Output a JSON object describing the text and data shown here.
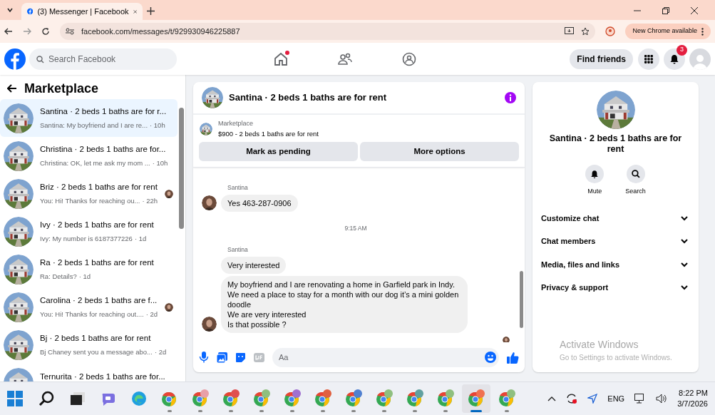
{
  "browser": {
    "tab_title": "(3) Messenger | Facebook",
    "url": "facebook.com/messages/t/929930946225887",
    "update_label": "New Chrome available"
  },
  "header": {
    "search_placeholder": "Search Facebook",
    "find_friends": "Find friends",
    "notification_count": "3"
  },
  "sidebar": {
    "title": "Marketplace",
    "conversations": [
      {
        "title": "Santina · 2 beds 1 baths are for r...",
        "preview": "Santina: My boyfriend and I are re...",
        "time": "· 10h",
        "selected": true,
        "seen_avatar": false
      },
      {
        "title": "Christina · 2 beds 1 baths are for...",
        "preview": "Christina: OK, let me ask my mom ...",
        "time": "· 10h",
        "selected": false,
        "seen_avatar": false
      },
      {
        "title": "Briz · 2 beds 1 baths are for rent",
        "preview": "You: Hi! Thanks for reaching ou...",
        "time": "· 22h",
        "selected": false,
        "seen_avatar": true
      },
      {
        "title": "Ivy · 2 beds 1 baths are for rent",
        "preview": "Ivy: My number is 6187377226",
        "time": "· 1d",
        "selected": false,
        "seen_avatar": false
      },
      {
        "title": "Ra · 2 beds 1 baths are for rent",
        "preview": "Ra: Details?",
        "time": "· 1d",
        "selected": false,
        "seen_avatar": false
      },
      {
        "title": "Carolina · 2 beds 1 baths are f...",
        "preview": "You: Hi! Thanks for reaching out....",
        "time": "· 2d",
        "selected": false,
        "seen_avatar": true
      },
      {
        "title": "Bj · 2 beds 1 baths are for rent",
        "preview": "Bj Chaney sent you a message abo...",
        "time": "· 2d",
        "selected": false,
        "seen_avatar": false
      },
      {
        "title": "Ternurita · 2 beds 1 baths are for...",
        "selected": false,
        "seen_avatar": false
      }
    ]
  },
  "chat": {
    "title": "Santina · 2 beds 1 baths are for rent",
    "listing_source": "Marketplace",
    "listing_text": "$900 - 2 beds 1 baths are for rent",
    "buttons": [
      "Mark as pending",
      "More options"
    ],
    "messages": [
      {
        "kind": "sender",
        "text": "Santina"
      },
      {
        "kind": "bubble",
        "text": "Yes 463-287-0906",
        "avatar": true
      },
      {
        "kind": "time",
        "text": "9:15 AM"
      },
      {
        "kind": "sender",
        "text": "Santina"
      },
      {
        "kind": "bubble",
        "text": "Very interested",
        "avatar": false
      },
      {
        "kind": "bubble",
        "text": "My boyfriend and I are renovating a home in Garfield park in Indy.\nWe need a place to stay for a month with our dog it’s a mini golden doodle\nWe are very interested\nIs that possible ?",
        "avatar": true
      }
    ],
    "composer_placeholder": "Aa"
  },
  "info": {
    "title": "Santina · 2 beds 1 baths are for rent",
    "actions": [
      "Mute",
      "Search"
    ],
    "sections": [
      "Customize chat",
      "Chat members",
      "Media, files and links",
      "Privacy & support"
    ],
    "activation_title": "Activate Windows",
    "activation_text": "Go to Settings to activate Windows."
  },
  "taskbar": {
    "apps": [
      {
        "kind": "search",
        "selected": false
      },
      {
        "kind": "taskview",
        "selected": false
      },
      {
        "kind": "meet",
        "selected": false
      },
      {
        "kind": "edge",
        "selected": false
      },
      {
        "kind": "chrome",
        "selected": false
      },
      {
        "kind": "chrome-profile",
        "color": "#e8a0a8",
        "selected": false
      },
      {
        "kind": "chrome-profile",
        "color": "#e05050",
        "selected": false
      },
      {
        "kind": "chrome-profile",
        "color": "#8fbf7f",
        "selected": false
      },
      {
        "kind": "chrome-profile",
        "color": "#a070d0",
        "selected": false
      },
      {
        "kind": "chrome-profile",
        "color": "#e06040",
        "selected": false
      },
      {
        "kind": "chrome-profile",
        "color": "#5080d0",
        "selected": false
      },
      {
        "kind": "chrome-profile",
        "color": "#8fbf7f",
        "selected": false
      },
      {
        "kind": "chrome-profile",
        "color": "#60a0a0",
        "selected": false
      },
      {
        "kind": "chrome-profile",
        "color": "#8fbf7f",
        "selected": false
      },
      {
        "kind": "chrome-profile",
        "color": "#f07050",
        "selected": true
      },
      {
        "kind": "chrome-profile",
        "color": "#8fbf7f",
        "selected": false
      }
    ],
    "language": "ENG",
    "time": "8:22 PM",
    "date": "3/7/2026"
  }
}
